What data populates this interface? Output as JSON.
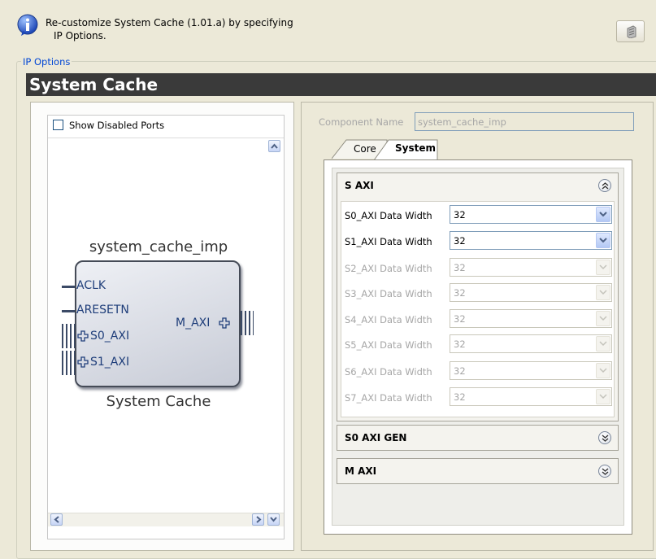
{
  "header": {
    "line1": "Re-customize System Cache (1.01.a) by specifying",
    "line2": "IP Options.",
    "info_icon": "info-icon",
    "doc_icon": "document-icon"
  },
  "group": {
    "label": "IP Options",
    "title": "System Cache"
  },
  "symbol_panel": {
    "show_disabled_label": "Show Disabled Ports",
    "show_disabled_checked": false,
    "instance_name": "system_cache_imp",
    "block_name": "System Cache",
    "ports_left": [
      "ACLK",
      "ARESETN",
      "S0_AXI",
      "S1_AXI"
    ],
    "ports_right": [
      "M_AXI"
    ]
  },
  "config": {
    "component_name_label": "Component Name",
    "component_name_value": "system_cache_imp",
    "tabs": [
      "Core",
      "System"
    ],
    "active_tab": "System",
    "sections": {
      "s_axi": {
        "title": "S AXI",
        "rows": [
          {
            "label": "S0_AXI Data Width",
            "value": "32",
            "enabled": true
          },
          {
            "label": "S1_AXI Data Width",
            "value": "32",
            "enabled": true
          },
          {
            "label": "S2_AXI Data Width",
            "value": "32",
            "enabled": false
          },
          {
            "label": "S3_AXI Data Width",
            "value": "32",
            "enabled": false
          },
          {
            "label": "S4_AXI Data Width",
            "value": "32",
            "enabled": false
          },
          {
            "label": "S5_AXI Data Width",
            "value": "32",
            "enabled": false
          },
          {
            "label": "S6_AXI Data Width",
            "value": "32",
            "enabled": false
          },
          {
            "label": "S7_AXI Data Width",
            "value": "32",
            "enabled": false
          }
        ]
      },
      "s0_axi_gen": {
        "title": "S0 AXI GEN"
      },
      "m_axi": {
        "title": "M AXI"
      }
    }
  },
  "colors": {
    "background": "#ece9d8",
    "title_bar": "#3a3a3a",
    "link_blue": "#0046d5",
    "block_fill": "#d4d7e0"
  }
}
